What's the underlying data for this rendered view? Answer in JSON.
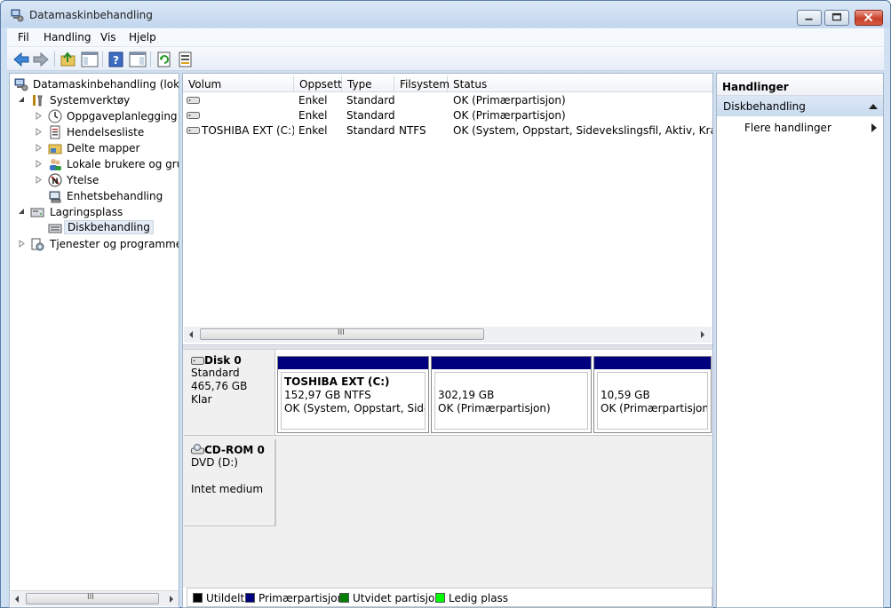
{
  "window": {
    "title": "Datamaskinbehandling"
  },
  "menu": [
    "Fil",
    "Handling",
    "Vis",
    "Hjelp"
  ],
  "toolbar_icons": [
    "back-arrow-icon",
    "forward-arrow-icon",
    "up-folder-icon",
    "show-tree-icon",
    "help-icon",
    "show-action-pane-icon",
    "refresh-icon",
    "export-list-icon"
  ],
  "tree": {
    "root": "Datamaskinbehandling (lokal)",
    "systemverktoy": "Systemverktøy",
    "oppgaveplanlegging": "Oppgaveplanlegging",
    "hendelsesliste": "Hendelsesliste",
    "delte_mapper": "Delte mapper",
    "lokale_brukere": "Lokale brukere og grupp",
    "ytelse": "Ytelse",
    "enhetsbehandling": "Enhetsbehandling",
    "lagringsplass": "Lagringsplass",
    "diskbehandling": "Diskbehandling",
    "tjenester": "Tjenester og programmer"
  },
  "volume_list": {
    "headers": {
      "volum": "Volum",
      "oppsett": "Oppsett",
      "type": "Type",
      "filsystem": "Filsystem",
      "status": "Status"
    },
    "rows": [
      {
        "volum": "",
        "oppsett": "Enkel",
        "type": "Standard",
        "filsystem": "",
        "status": "OK (Primærpartisjon)"
      },
      {
        "volum": "",
        "oppsett": "Enkel",
        "type": "Standard",
        "filsystem": "",
        "status": "OK (Primærpartisjon)"
      },
      {
        "volum": "TOSHIBA EXT (C:)",
        "oppsett": "Enkel",
        "type": "Standard",
        "filsystem": "NTFS",
        "status": "OK (System, Oppstart, Sidevekslingsfil, Aktiv, Krasjdump"
      }
    ]
  },
  "disks": {
    "disk0": {
      "name": "Disk 0",
      "type": "Standard",
      "size": "465,76 GB",
      "state": "Klar",
      "partitions": [
        {
          "name": "TOSHIBA EXT  (C:)",
          "size": "152,97 GB NTFS",
          "status": "OK (System, Oppstart, Sidevel"
        },
        {
          "name": "",
          "size": "302,19 GB",
          "status": "OK (Primærpartisjon)"
        },
        {
          "name": "",
          "size": "10,59 GB",
          "status": "OK (Primærpartisjon)"
        }
      ]
    },
    "cdrom0": {
      "name": "CD-ROM 0",
      "drive": "DVD (D:)",
      "media": "Intet medium"
    }
  },
  "legend": [
    {
      "label": "Utildelt",
      "color": "#000000"
    },
    {
      "label": "Primærpartisjon",
      "color": "#00007f"
    },
    {
      "label": "Utvidet partisjon",
      "color": "#008000"
    },
    {
      "label": "Ledig plass",
      "color": "#00ff00"
    }
  ],
  "actions": {
    "header": "Handlinger",
    "section": "Diskbehandling",
    "item": "Flere handlinger"
  },
  "scroll": {
    "h": "III"
  }
}
